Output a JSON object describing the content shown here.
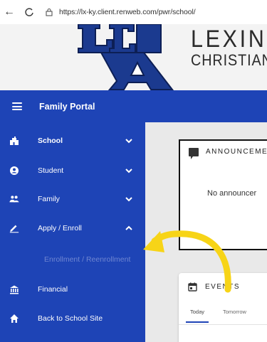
{
  "browser": {
    "url": "https://lx-ky.client.renweb.com/pwr/school/",
    "back_glyph": "←",
    "reload_glyph": "C"
  },
  "school": {
    "logo_text": "LCA",
    "name_line1": "LEXING",
    "name_line2": "CHRISTIAN A"
  },
  "topbar": {
    "title": "Family Portal"
  },
  "sidebar": {
    "items": [
      {
        "label": "School",
        "icon": "building-icon"
      },
      {
        "label": "Student",
        "icon": "person-icon"
      },
      {
        "label": "Family",
        "icon": "people-icon"
      },
      {
        "label": "Apply / Enroll",
        "icon": "pencil-icon"
      },
      {
        "label": "Financial",
        "icon": "bank-icon"
      },
      {
        "label": "Back to School Site",
        "icon": "home-icon"
      }
    ],
    "sub_items": [
      {
        "label": "Enrollment / Reenrollment"
      }
    ]
  },
  "main": {
    "announcements": {
      "title": "ANNOUNCEME",
      "empty_text": "No announcer"
    },
    "events": {
      "title": "EVENTS",
      "tabs": [
        "Today",
        "Tomorrow"
      ]
    }
  },
  "colors": {
    "brand_blue": "#1e44b6",
    "submenu_text": "#6f86d1",
    "arrow_yellow": "#f7d417",
    "logo_navy": "#1b3a8f"
  }
}
